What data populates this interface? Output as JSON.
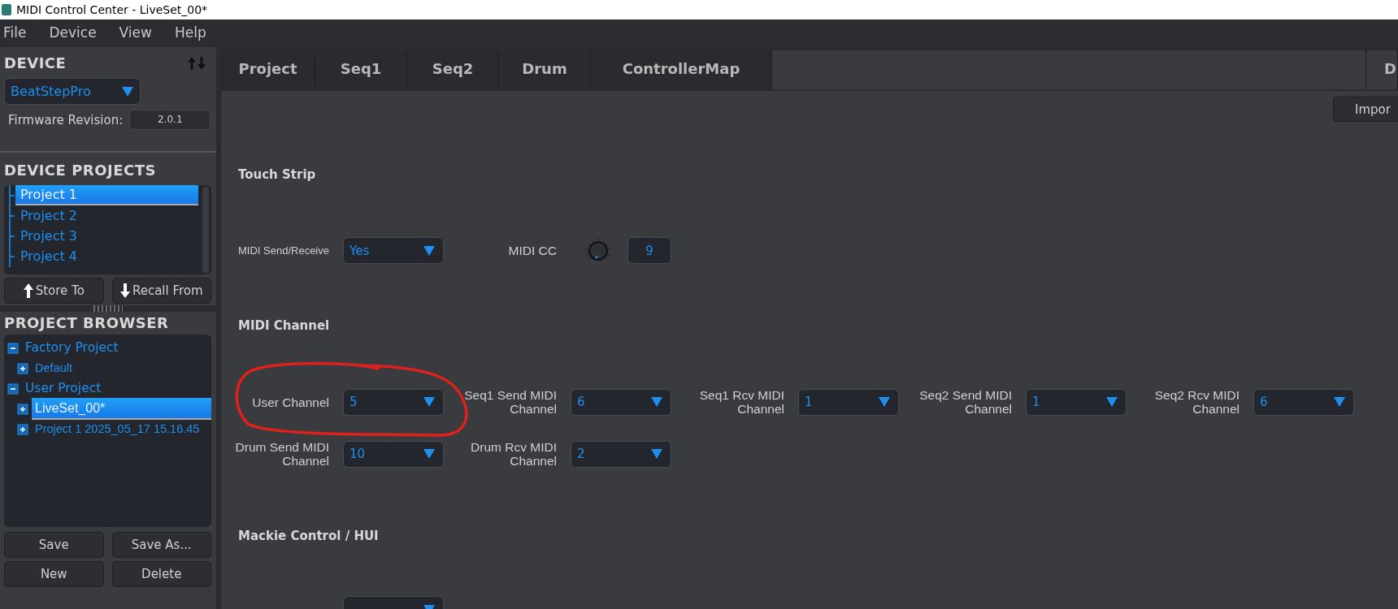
{
  "window": {
    "title": "MIDI Control Center - LiveSet_00*"
  },
  "menu": [
    "File",
    "Device",
    "View",
    "Help"
  ],
  "device_panel": {
    "heading": "DEVICE",
    "device": "BeatStepPro",
    "firmware_label": "Firmware Revision:",
    "firmware": "2.0.1"
  },
  "device_projects": {
    "heading": "DEVICE PROJECTS",
    "items": [
      {
        "label": "Project 1",
        "selected": true
      },
      {
        "label": "Project 2",
        "selected": false
      },
      {
        "label": "Project 3",
        "selected": false
      },
      {
        "label": "Project 4",
        "selected": false
      }
    ],
    "buttons": [
      "Store To",
      "Recall From"
    ]
  },
  "project_browser": {
    "heading": "PROJECT BROWSER",
    "tree": [
      {
        "label": "Factory Project",
        "expanded": true,
        "selected": false,
        "children": [
          {
            "label": "Default",
            "expanded": false,
            "selected": false
          }
        ]
      },
      {
        "label": "User Project",
        "expanded": true,
        "selected": false,
        "children": [
          {
            "label": "LiveSet_00*",
            "expanded": false,
            "selected": true
          },
          {
            "label": "Project 1 2025_05_17 15.16.45",
            "expanded": false,
            "selected": false
          }
        ]
      }
    ],
    "buttons": [
      "Save",
      "Save As...",
      "New",
      "Delete"
    ]
  },
  "tabs": [
    {
      "label": "Project",
      "selected": false
    },
    {
      "label": "Seq1",
      "selected": false
    },
    {
      "label": "Seq2",
      "selected": false
    },
    {
      "label": "Drum",
      "selected": false
    },
    {
      "label": "ControllerMap",
      "selected": false
    }
  ],
  "side_tab": {
    "label": "D"
  },
  "import_button": "Impor",
  "sections": [
    {
      "heading": "Touch Strip",
      "controls": [
        {
          "kind": "dropdown",
          "label": "MIDI Send/Receive",
          "value": "Yes"
        },
        {
          "kind": "knob",
          "label": "MIDI CC",
          "value": "9"
        }
      ]
    },
    {
      "heading": "MIDI Channel",
      "controls": [
        {
          "kind": "dropdown",
          "label": "User Channel",
          "value": "5"
        },
        {
          "kind": "dropdown",
          "label": "Seq1 Send MIDI Channel",
          "value": "6"
        },
        {
          "kind": "dropdown",
          "label": "Seq1 Rcv MIDI Channel",
          "value": "1"
        },
        {
          "kind": "dropdown",
          "label": "Seq2 Send MIDI Channel",
          "value": "1"
        },
        {
          "kind": "dropdown",
          "label": "Seq2 Rcv MIDI Channel",
          "value": "6"
        },
        {
          "kind": "dropdown",
          "label": "Drum Send MIDI Channel",
          "value": "10"
        },
        {
          "kind": "dropdown",
          "label": "Drum Rcv MIDI Channel",
          "value": "2"
        }
      ]
    },
    {
      "heading": "Mackie Control / HUI",
      "controls": [
        {
          "kind": "dropdown"
        }
      ]
    }
  ]
}
